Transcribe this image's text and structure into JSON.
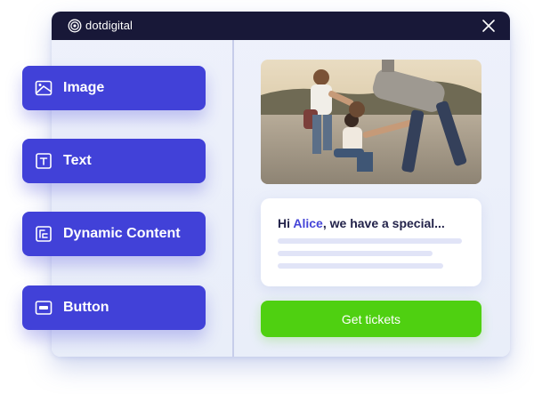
{
  "app": {
    "brand": "dotdigital"
  },
  "colors": {
    "titlebar": "#181838",
    "block_button": "#4141d8",
    "cta": "#4fd011",
    "accent_name": "#4545d8",
    "panel_bg": "#eef1fb"
  },
  "content_blocks": [
    {
      "label": "Image",
      "icon": "image-icon"
    },
    {
      "label": "Text",
      "icon": "text-icon"
    },
    {
      "label": "Dynamic Content",
      "icon": "dynamic-content-icon"
    },
    {
      "label": "Button",
      "icon": "button-icon"
    }
  ],
  "preview": {
    "greeting_prefix": "Hi ",
    "recipient_name": "Alice",
    "greeting_suffix": ", we have a special...",
    "cta_label": "Get tickets",
    "image_alt": "friends-photo"
  }
}
